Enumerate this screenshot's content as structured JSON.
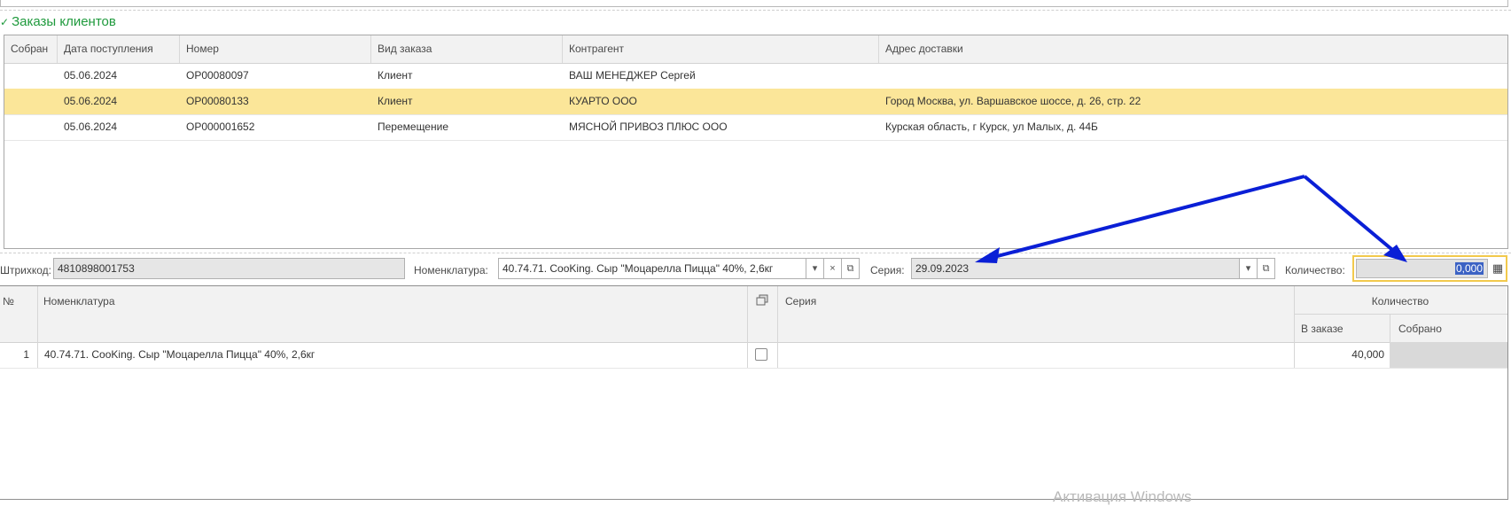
{
  "section": {
    "title": "Заказы клиентов",
    "chevron_icon": "chevron-down-icon"
  },
  "orders": {
    "columns": [
      "Собран",
      "Дата поступления",
      "Номер",
      "Вид заказа",
      "Контрагент",
      "Адрес доставки"
    ],
    "rows": [
      {
        "collected": "",
        "date": "05.06.2024",
        "number": "ОР00080097",
        "type": "Клиент",
        "counterparty": "ВАШ МЕНЕДЖЕР Сергей",
        "address": ""
      },
      {
        "collected": "",
        "date": "05.06.2024",
        "number": "ОР00080133",
        "type": "Клиент",
        "counterparty": "КУАРТО ООО",
        "address": "Город Москва, ул. Варшавское шоссе, д. 26, стр. 22"
      },
      {
        "collected": "",
        "date": "05.06.2024",
        "number": "ОР000001652",
        "type": "Перемещение",
        "counterparty": "МЯСНОЙ ПРИВОЗ ПЛЮС ООО",
        "address": "Курская область, г Курск, ул Малых, д. 44Б"
      }
    ],
    "selected_row": 1,
    "selected_color": "#fbe699"
  },
  "filters": {
    "barcode_label": "Штрихкод:",
    "barcode_value": "4810898001753",
    "nomenclature_label": "Номенклатура:",
    "nomenclature_value": "40.74.71. CooKing. Сыр \"Моцарелла Пицца\" 40%, 2,6кг",
    "series_label": "Серия:",
    "series_value": "29.09.2023",
    "quantity_label": "Количество:",
    "quantity_value": "0,000"
  },
  "items": {
    "col_no": "№",
    "col_nomenclature": "Номенклатура",
    "col_series": "Серия",
    "col_quantity": "Количество",
    "col_in_order": "В заказе",
    "col_collected": "Собрано",
    "rows": [
      {
        "no": "1",
        "nomenclature": "40.74.71. CooKing. Сыр \"Моцарелла Пицца\" 40%, 2,6кг",
        "series": "",
        "in_order": "40,000",
        "collected": ""
      }
    ]
  },
  "watermark": "Активация Windows",
  "colors": {
    "accent_green": "#1f9a3d",
    "annotation_arrow": "#0a1fd6",
    "focus_border": "#f2c94c"
  }
}
